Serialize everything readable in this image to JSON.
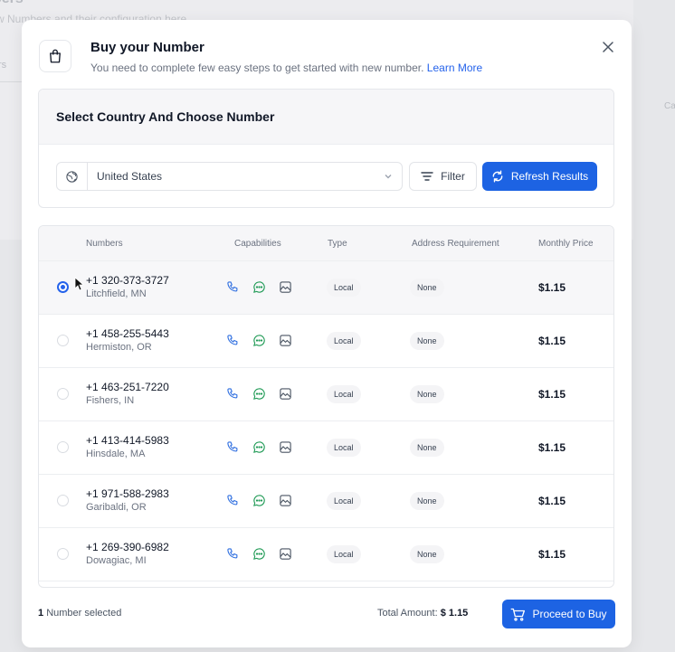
{
  "background": {
    "title": "bers",
    "subtitle": "w Numbers and their configuration here",
    "tab": "rs",
    "column": "Ca"
  },
  "modal": {
    "icon": "shopping-bag-icon",
    "title": "Buy your Number",
    "subtitle": "You need to complete few easy steps to get started with new number.",
    "learn_more": "Learn More",
    "close_icon": "close-icon"
  },
  "country_section": {
    "heading": "Select Country And Choose Number",
    "country_value": "United States",
    "filter_label": "Filter",
    "refresh_label": "Refresh Results"
  },
  "table": {
    "columns": [
      "Numbers",
      "Capabilities",
      "Type",
      "Address Requirement",
      "Monthly Price"
    ],
    "rows": [
      {
        "selected": true,
        "number": "+1 320-373-3727",
        "location": "Litchfield, MN",
        "type": "Local",
        "address": "None",
        "price": "$1.15"
      },
      {
        "selected": false,
        "number": "+1 458-255-5443",
        "location": "Hermiston, OR",
        "type": "Local",
        "address": "None",
        "price": "$1.15"
      },
      {
        "selected": false,
        "number": "+1 463-251-7220",
        "location": "Fishers, IN",
        "type": "Local",
        "address": "None",
        "price": "$1.15"
      },
      {
        "selected": false,
        "number": "+1 413-414-5983",
        "location": "Hinsdale, MA",
        "type": "Local",
        "address": "None",
        "price": "$1.15"
      },
      {
        "selected": false,
        "number": "+1 971-588-2983",
        "location": "Garibaldi, OR",
        "type": "Local",
        "address": "None",
        "price": "$1.15"
      },
      {
        "selected": false,
        "number": "+1 269-390-6982",
        "location": "Dowagiac, MI",
        "type": "Local",
        "address": "None",
        "price": "$1.15"
      }
    ]
  },
  "footer": {
    "selected_count": "1",
    "selected_label": "Number selected",
    "total_label": "Total Amount:",
    "total_value": "$ 1.15",
    "buy_label": "Proceed to Buy"
  },
  "colors": {
    "primary": "#1d63e3",
    "link": "#2563eb",
    "voice_icon": "#2f6fe0",
    "sms_icon": "#1f9a55",
    "mms_icon": "#4b5563"
  }
}
